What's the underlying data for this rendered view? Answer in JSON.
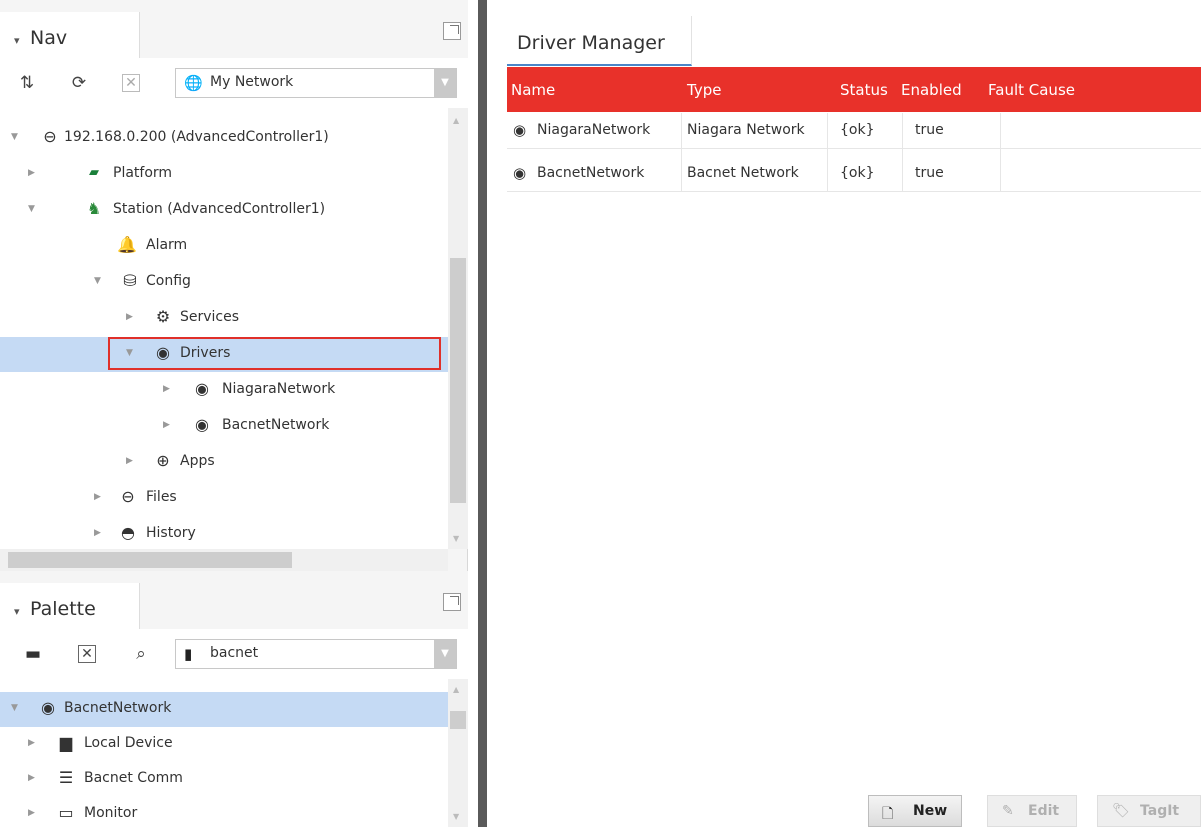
{
  "nav": {
    "title": "Nav",
    "network_selector": "My Network",
    "tree": [
      {
        "label": "192.168.0.200 (AdvancedController1)",
        "icon": "network-host-icon",
        "expanded": true
      },
      {
        "label": "Platform",
        "icon": "platform-icon",
        "expanded": false
      },
      {
        "label": "Station (AdvancedController1)",
        "icon": "station-icon",
        "expanded": true
      },
      {
        "label": "Alarm",
        "icon": "bell-icon"
      },
      {
        "label": "Config",
        "icon": "database-icon",
        "expanded": true
      },
      {
        "label": "Services",
        "icon": "services-icon",
        "expanded": false
      },
      {
        "label": "Drivers",
        "icon": "driver-icon",
        "expanded": true,
        "selected": true
      },
      {
        "label": "NiagaraNetwork",
        "icon": "driver-icon",
        "expanded": false
      },
      {
        "label": "BacnetNetwork",
        "icon": "driver-icon",
        "expanded": false
      },
      {
        "label": "Apps",
        "icon": "apps-icon",
        "expanded": false
      },
      {
        "label": "Files",
        "icon": "files-icon",
        "expanded": false
      },
      {
        "label": "History",
        "icon": "history-icon",
        "expanded": false
      }
    ]
  },
  "palette": {
    "title": "Palette",
    "module_selector": "bacnet",
    "tree": [
      {
        "label": "BacnetNetwork",
        "icon": "driver-icon",
        "expanded": true,
        "selected": true
      },
      {
        "label": "Local Device",
        "icon": "device-icon",
        "expanded": false
      },
      {
        "label": "Bacnet Comm",
        "icon": "comm-icon",
        "expanded": false
      },
      {
        "label": "Monitor",
        "icon": "monitor-icon",
        "expanded": false
      }
    ]
  },
  "main": {
    "tab": "Driver Manager",
    "columns": [
      "Name",
      "Type",
      "Status",
      "Enabled",
      "Fault Cause"
    ],
    "rows": [
      {
        "name": "NiagaraNetwork",
        "type": "Niagara Network",
        "status": "{ok}",
        "enabled": "true",
        "fault": ""
      },
      {
        "name": "BacnetNetwork",
        "type": "Bacnet Network",
        "status": "{ok}",
        "enabled": "true",
        "fault": ""
      }
    ],
    "buttons": {
      "new": "New",
      "edit": "Edit",
      "tagit": "TagIt"
    }
  },
  "colors": {
    "header_red": "#e8312a",
    "selection_blue": "#c5daf4",
    "highlight_border": "#e0302a"
  }
}
